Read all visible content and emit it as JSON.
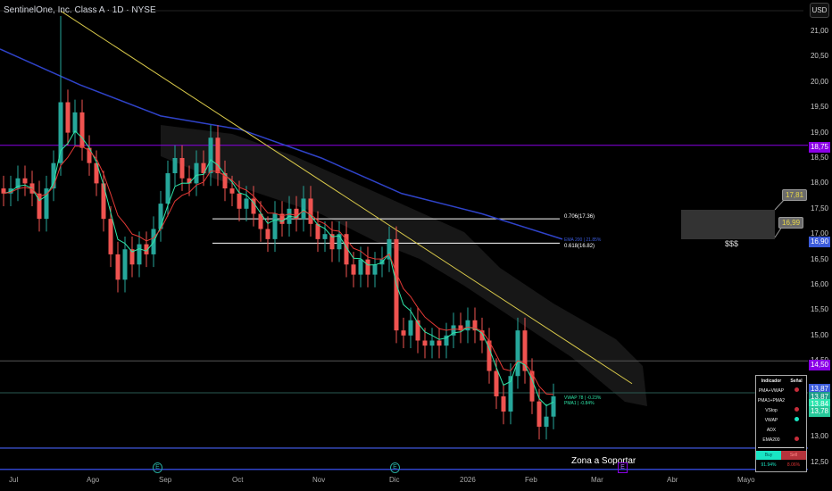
{
  "header": {
    "title": "SentinelOne, Inc. Class A · 1D · NYSE",
    "currency": "USD"
  },
  "colors": {
    "up": "#26a69a",
    "down": "#ef5350",
    "ema200": "#2f43c9",
    "trendline": "#d8c84a",
    "purple": "#8a00e6",
    "vwap": "#2ee6a8",
    "ma_fast": "#e53935",
    "ma_slow": "#26a69a"
  },
  "chart_data": {
    "type": "candlestick",
    "symbol": "SentinelOne, Inc. Class A",
    "interval": "1D",
    "ylim": [
      12.3,
      21.5
    ],
    "y_ticks": [
      "21,00",
      "20,50",
      "20,00",
      "19,50",
      "19,00",
      "18,50",
      "18,00",
      "17,50",
      "17,00",
      "16,50",
      "16,00",
      "15,50",
      "15,00",
      "14,50",
      "13,00",
      "12,50"
    ],
    "y_tick_values": [
      21,
      20.5,
      20,
      19.5,
      19,
      18.5,
      18,
      17.5,
      17,
      16.5,
      16,
      15.5,
      15,
      14.5,
      13,
      12.5
    ],
    "x_ticks": [
      "Jul",
      "Ago",
      "Sep",
      "Oct",
      "Nov",
      "Dic",
      "2026",
      "Feb",
      "Mar",
      "Abr",
      "Mayo"
    ],
    "closes": [
      17.8,
      17.9,
      18.1,
      18.0,
      17.8,
      17.3,
      17.9,
      18.4,
      19.6,
      19.0,
      19.4,
      18.7,
      18.4,
      18.0,
      17.3,
      16.6,
      16.1,
      16.7,
      16.4,
      16.8,
      16.6,
      17.1,
      17.6,
      18.2,
      18.5,
      18.1,
      18.0,
      18.4,
      18.2,
      18.9,
      18.2,
      17.9,
      17.8,
      17.5,
      17.7,
      17.4,
      17.1,
      16.9,
      17.4,
      17.2,
      17.5,
      17.3,
      17.7,
      17.2,
      16.9,
      17.0,
      16.7,
      17.0,
      16.4,
      16.2,
      16.5,
      16.2,
      16.4,
      16.5,
      16.9,
      15.1,
      15.0,
      15.3,
      14.9,
      14.8,
      14.9,
      14.8,
      15.0,
      15.2,
      15.1,
      15.3,
      15.1,
      14.9,
      14.3,
      13.8,
      13.5,
      14.2,
      15.1,
      14.3,
      13.7,
      13.2,
      13.4,
      13.8
    ],
    "spike_high": 21.3,
    "ema200": [
      20.65,
      19.94,
      19.33,
      19.06,
      18.5,
      17.8,
      17.4,
      16.9
    ],
    "trendline": {
      "start": 21.4,
      "end": 14.05
    },
    "price_labels": [
      {
        "value": "18,75",
        "color": "#8a00e6"
      },
      {
        "value": "16,90",
        "color": "#3b5bdb"
      },
      {
        "value": "14,50",
        "color": "#8a00e6"
      },
      {
        "value": "13,87",
        "color": "#3b5bdb"
      },
      {
        "value": "13,87",
        "color": "#1e9e8a"
      },
      {
        "value": "13,84",
        "color": "#2ee6b0"
      },
      {
        "value": "13,78",
        "color": "#26c99a"
      }
    ],
    "levels": [
      18.75,
      14.5,
      13.87,
      12.78,
      12.36
    ],
    "fib": [
      {
        "label": "0.706(17.36)",
        "value": 17.3
      },
      {
        "label": "0.618(16.82)",
        "value": 16.82
      }
    ],
    "annotations": {
      "ema_label": "EMA 200 | 21.85%",
      "vwap_label": "VWAP 78 | -0.23%",
      "pma_label": "PMA1 | -0.84%",
      "zone": "Zona a Soportar",
      "target": "$$$",
      "callout_high": "17,81",
      "callout_low": "16,99",
      "earnings": "E"
    }
  },
  "signal_table": {
    "headers": [
      "Indicador",
      "Señal"
    ],
    "rows": [
      {
        "name": "PMA+VWAP",
        "signal": "sell"
      },
      {
        "name": "PMA1+PMA2",
        "signal": ""
      },
      {
        "name": "VStop",
        "signal": "sell"
      },
      {
        "name": "VWAP",
        "signal": "buy"
      },
      {
        "name": "ADX",
        "signal": ""
      },
      {
        "name": "EMA200",
        "signal": "sell"
      }
    ],
    "buy_label": "Buy",
    "sell_label": "Sell",
    "buy_pct": "91.94%",
    "sell_pct": "8.06%"
  }
}
